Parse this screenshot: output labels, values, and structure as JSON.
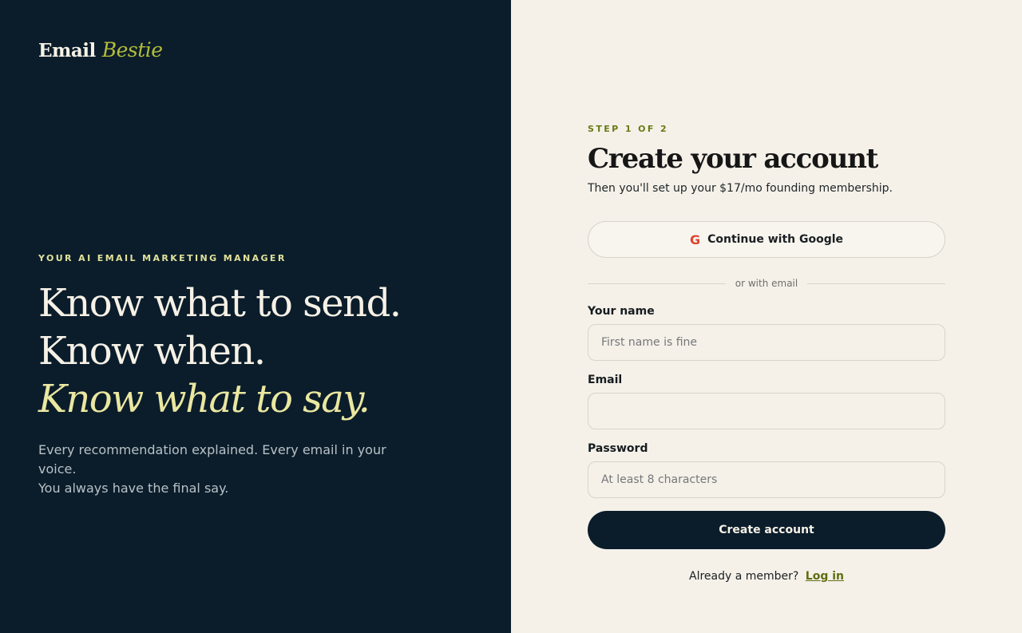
{
  "brand": {
    "word": "Email",
    "script": "Bestie"
  },
  "hero": {
    "eyebrow": "YOUR AI EMAIL MARKETING MANAGER",
    "line1": "Know what to send.",
    "line2": "Know when.",
    "line3": "Know what to say.",
    "sub_line1": "Every recommendation explained. Every email in your voice.",
    "sub_line2": "You always have the final say."
  },
  "form": {
    "step": "STEP 1 OF 2",
    "title": "Create your account",
    "subtitle": "Then you'll set up your $17/mo founding membership.",
    "google_label": "Continue with Google",
    "google_icon_glyph": "G",
    "divider": "or with email",
    "name_label": "Your name",
    "name_placeholder": "First name is fine",
    "name_value": "",
    "email_label": "Email",
    "email_placeholder": "",
    "email_value": "",
    "password_label": "Password",
    "password_placeholder": "At least 8 characters",
    "password_value": "",
    "submit_label": "Create account",
    "footer_text": "Already a member?",
    "login_link": "Log in"
  },
  "colors": {
    "left_bg": "#0b1d2b",
    "right_bg": "#f5f1e9",
    "accent_olive": "#6a7a15",
    "accent_cream": "#eae7a0",
    "google_red": "#de4431"
  },
  "icons": {
    "google": "google-icon"
  }
}
